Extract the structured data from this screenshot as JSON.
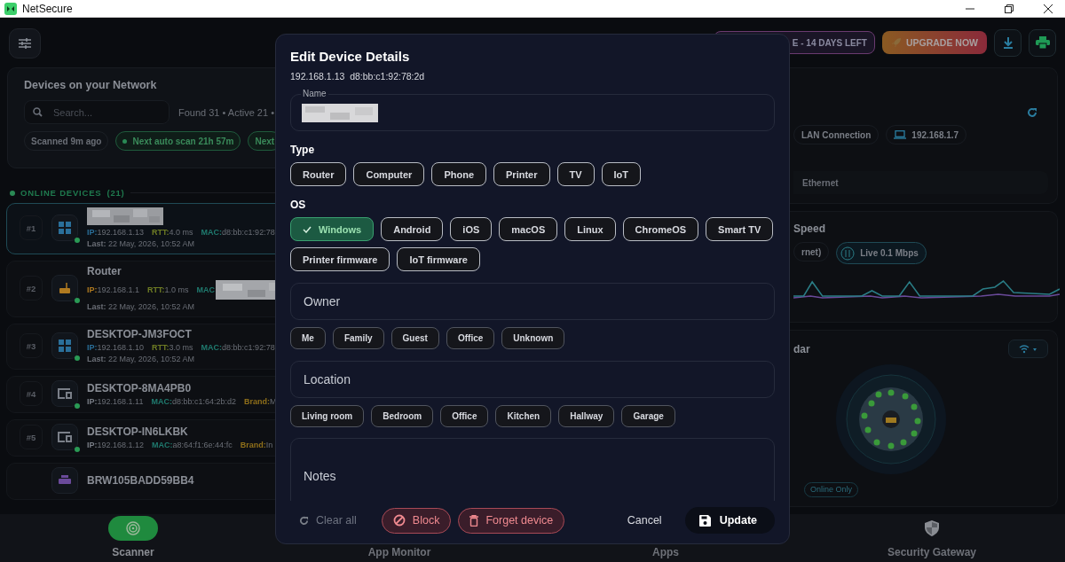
{
  "window": {
    "title": "NetSecure"
  },
  "toolbar": {
    "trial_badge": "E - 14 DAYS LEFT",
    "upgrade_button": "UPGRADE NOW"
  },
  "devices_panel": {
    "title": "Devices on your Network",
    "search": {
      "placeholder": "Search..."
    },
    "stats": "Found 31 • Active 21 •",
    "chips": [
      {
        "label": "Scanned 9m ago",
        "kind": "plain"
      },
      {
        "label": "Next auto scan 21h 57m",
        "kind": "live"
      },
      {
        "label": "Next",
        "kind": "next"
      }
    ]
  },
  "online_section": {
    "title": "ONLINE DEVICES",
    "count": "(21)"
  },
  "devices": [
    {
      "index": "#1",
      "selected": true,
      "online": true,
      "kind": "computer",
      "color": "#2a6f9a",
      "redacted": true,
      "fields": [
        {
          "kind": "ip",
          "label": "IP:",
          "value": "192.168.1.13"
        },
        {
          "kind": "rtt",
          "label": "RTT:",
          "value": "4.0 ms"
        },
        {
          "kind": "mac",
          "label": "MAC:",
          "value": "d8:bb:c1:92:78"
        }
      ],
      "last": {
        "label": "Last:",
        "value": "22 May, 2026, 10:52 AM"
      }
    },
    {
      "index": "#2",
      "selected": false,
      "online": true,
      "kind": "router",
      "color": "#b07a20",
      "name": "Router",
      "fields": [
        {
          "kind": "ip",
          "label": "IP:",
          "value": "192.168.1.1"
        },
        {
          "kind": "rtt",
          "label": "RTT:",
          "value": "1.0 ms"
        },
        {
          "kind": "mac",
          "label": "MAC",
          "redacted": true
        }
      ],
      "last": {
        "label": "Last:",
        "value": "22 May, 2026, 10:52 AM"
      }
    },
    {
      "index": "#3",
      "selected": false,
      "online": true,
      "kind": "computer",
      "color": "#2a6f9a",
      "name": "DESKTOP-JM3FOCT",
      "fields": [
        {
          "kind": "ip",
          "label": "IP:",
          "value": "192.168.1.10"
        },
        {
          "kind": "rtt",
          "label": "RTT:",
          "value": "3.0 ms"
        },
        {
          "kind": "mac",
          "label": "MAC:",
          "value": "d8:bb:c1:92:78"
        }
      ],
      "last": {
        "label": "Last:",
        "value": "22 May, 2026, 10:52 AM"
      }
    },
    {
      "index": "#4",
      "selected": false,
      "online": true,
      "kind": "generic",
      "color": "#7a7f88",
      "name": "DESKTOP-8MA4PB0",
      "fields": [
        {
          "kind": "ip",
          "label": "IP:",
          "value": "192.168.1.11"
        },
        {
          "kind": "mac",
          "label": "MAC:",
          "value": "d8:bb:c1:64:2b:d2"
        },
        {
          "kind": "brand",
          "label": "Brand:",
          "value": "M"
        }
      ]
    },
    {
      "index": "#5",
      "selected": false,
      "online": true,
      "kind": "generic",
      "color": "#7a7f88",
      "name": "DESKTOP-IN6LKBK",
      "fields": [
        {
          "kind": "ip",
          "label": "IP:",
          "value": "192.168.1.12"
        },
        {
          "kind": "mac",
          "label": "MAC:",
          "value": "a8:64:f1:6e:44:fc"
        },
        {
          "kind": "brand",
          "label": "Brand:",
          "value": "In"
        }
      ]
    },
    {
      "selected": false,
      "online": false,
      "kind": "printer",
      "color": "#6a4a9a",
      "name": "BRW105BADD59BB4"
    }
  ],
  "connection_card": {
    "chips": [
      {
        "label": "LAN Connection",
        "kind": "connection"
      },
      {
        "label": "192.168.1.7",
        "kind": "host"
      }
    ],
    "interface": "Ethernet"
  },
  "speed_card": {
    "title": "Speed",
    "chips": [
      {
        "label": "rnet)",
        "kind": "plain"
      },
      {
        "label": "Live 0.1 Mbps",
        "kind": "live"
      }
    ]
  },
  "radar_card": {
    "title": "dar",
    "filter_chip": "Online Only"
  },
  "dialog": {
    "title": "Edit Device Details",
    "ip": "192.168.1.13",
    "mac": "d8:bb:c1:92:78:2d",
    "name_field": {
      "label": "Name",
      "redacted": true
    },
    "type": {
      "label": "Type",
      "options": [
        {
          "label": "Router",
          "selected": false
        },
        {
          "label": "Computer",
          "selected": false
        },
        {
          "label": "Phone",
          "selected": false
        },
        {
          "label": "Printer",
          "selected": false
        },
        {
          "label": "TV",
          "selected": false
        },
        {
          "label": "IoT",
          "selected": false
        }
      ]
    },
    "os": {
      "label": "OS",
      "options": [
        {
          "label": "Windows",
          "selected": true
        },
        {
          "label": "Android",
          "selected": false
        },
        {
          "label": "iOS",
          "selected": false
        },
        {
          "label": "macOS",
          "selected": false
        },
        {
          "label": "Linux",
          "selected": false
        },
        {
          "label": "ChromeOS",
          "selected": false
        },
        {
          "label": "Smart TV",
          "selected": false
        },
        {
          "label": "Printer firmware",
          "selected": false
        },
        {
          "label": "IoT firmware",
          "selected": false
        }
      ]
    },
    "owner": {
      "placeholder": "Owner",
      "options": [
        {
          "label": "Me",
          "selected": false
        },
        {
          "label": "Family",
          "selected": false
        },
        {
          "label": "Guest",
          "selected": false
        },
        {
          "label": "Office",
          "selected": false
        },
        {
          "label": "Unknown",
          "selected": false
        }
      ]
    },
    "location": {
      "placeholder": "Location",
      "options": [
        {
          "label": "Living room",
          "selected": false
        },
        {
          "label": "Bedroom",
          "selected": false
        },
        {
          "label": "Office",
          "selected": false
        },
        {
          "label": "Kitchen",
          "selected": false
        },
        {
          "label": "Hallway",
          "selected": false
        },
        {
          "label": "Garage",
          "selected": false
        }
      ]
    },
    "notes": {
      "placeholder": "Notes"
    },
    "footer": {
      "clear": "Clear all",
      "block": "Block",
      "forget": "Forget device",
      "cancel": "Cancel",
      "update": "Update"
    }
  },
  "bottom_nav": [
    {
      "label": "Scanner",
      "selected": true,
      "kind": "scanner"
    },
    {
      "label": "App Monitor",
      "selected": false,
      "kind": "monitor"
    },
    {
      "label": "Apps",
      "selected": false,
      "kind": "apps"
    },
    {
      "label": "Security Gateway",
      "selected": false,
      "kind": "gateway"
    }
  ]
}
